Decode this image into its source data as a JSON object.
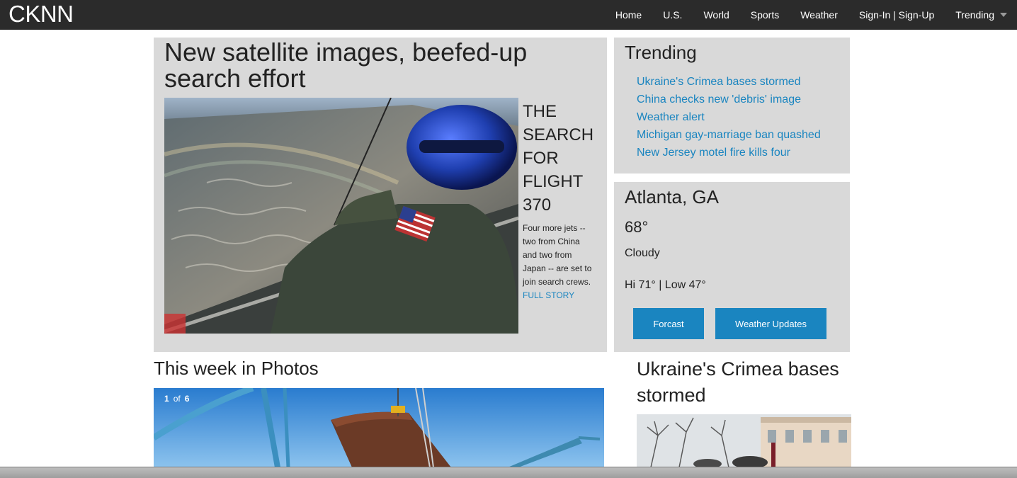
{
  "brand": "CKNN",
  "nav": {
    "items": [
      "Home",
      "U.S.",
      "World",
      "Sports",
      "Weather",
      "Sign-In | Sign-Up",
      "Trending"
    ]
  },
  "main_story": {
    "headline": "New satellite images, beefed-up search effort",
    "side_title": "THE SEARCH FOR FLIGHT 370",
    "side_text": "Four more jets -- two from China and two from Japan -- are set to join search crews.",
    "full_story_link": "FULL STORY"
  },
  "trending": {
    "title": "Trending",
    "items": [
      "Ukraine's Crimea bases stormed",
      "China checks new 'debris' image",
      "Weather alert",
      "Michigan gay-marriage ban quashed",
      "New Jersey motel fire kills four"
    ]
  },
  "weather": {
    "location": "Atlanta, GA",
    "temp": "68°",
    "condition": "Cloudy",
    "hilo": "Hi 71° | Low 47°",
    "forecast_button": "Forcast",
    "updates_button": "Weather Updates"
  },
  "photos": {
    "title": "This week in Photos",
    "current": "1",
    "of": "of",
    "total": "6"
  },
  "side_story": {
    "title": "Ukraine's Crimea bases stormed"
  },
  "colors": {
    "nav_bg": "#2b2b2b",
    "panel_bg": "#d9d9d9",
    "accent": "#1a85c0"
  },
  "icons": {
    "trending_caret": "chevron-down-icon"
  }
}
